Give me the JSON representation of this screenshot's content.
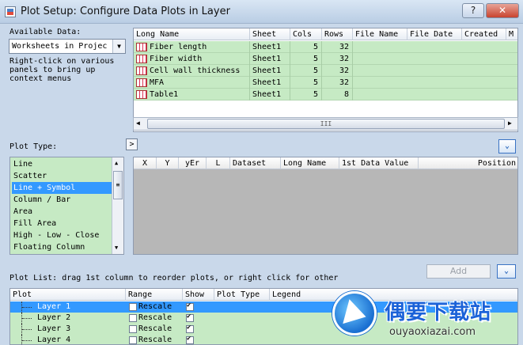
{
  "window": {
    "title": "Plot Setup: Configure Data Plots in Layer",
    "help_label": "?",
    "close_label": "✕"
  },
  "available_data": {
    "label": "Available Data:",
    "value": "Worksheets in Projec",
    "hint": "Right-click on various panels to bring up context menus"
  },
  "worksheets": {
    "columns": [
      "Long Name",
      "Sheet",
      "Cols",
      "Rows",
      "File Name",
      "File Date",
      "Created",
      "M"
    ],
    "rows": [
      {
        "name": "Fiber length",
        "sheet": "Sheet1",
        "cols": "5",
        "rows": "32"
      },
      {
        "name": "Fiber width",
        "sheet": "Sheet1",
        "cols": "5",
        "rows": "32"
      },
      {
        "name": "Cell wall thickness",
        "sheet": "Sheet1",
        "cols": "5",
        "rows": "32"
      },
      {
        "name": "MFA",
        "sheet": "Sheet1",
        "cols": "5",
        "rows": "32"
      },
      {
        "name": "Table1",
        "sheet": "Sheet1",
        "cols": "5",
        "rows": "8"
      }
    ],
    "scroll_left": "◀",
    "scroll_right": "▶",
    "scroll_grip": "III"
  },
  "plot_type": {
    "label": "Plot Type:",
    "arrow_label": ">",
    "items": [
      "Line",
      "Scatter",
      "Line + Symbol",
      "Column / Bar",
      "Area",
      "Fill Area",
      "High - Low - Close",
      "Floating Column"
    ],
    "selected": "Line + Symbol",
    "scroll_up": "▲",
    "scroll_down": "▼",
    "scroll_grip": "≡"
  },
  "expand_right_label": "⌄",
  "dataset_grid": {
    "columns": [
      "X",
      "Y",
      "yEr",
      "L",
      "Dataset",
      "Long Name",
      "1st Data Value",
      "Position"
    ]
  },
  "plot_list": {
    "label": "Plot List: drag 1st column to reorder plots, or right click for other",
    "add_label": "Add",
    "expand_label": "⌄",
    "columns": [
      "Plot",
      "Range",
      "Show",
      "Plot Type",
      "Legend"
    ],
    "rows": [
      {
        "name": "Layer 1",
        "range": "Rescale",
        "show": true
      },
      {
        "name": "Layer 2",
        "range": "Rescale",
        "show": true
      },
      {
        "name": "Layer 3",
        "range": "Rescale",
        "show": true
      },
      {
        "name": "Layer 4",
        "range": "Rescale",
        "show": true
      }
    ]
  },
  "watermark": {
    "name": "偶要下载站",
    "url": "ouyaoxiazai.com"
  },
  "colors": {
    "row_green": "#c6eac4",
    "selection_blue": "#3399ff",
    "dialog_bg": "#c9d8ea",
    "grid_gray": "#b7b7b7"
  }
}
